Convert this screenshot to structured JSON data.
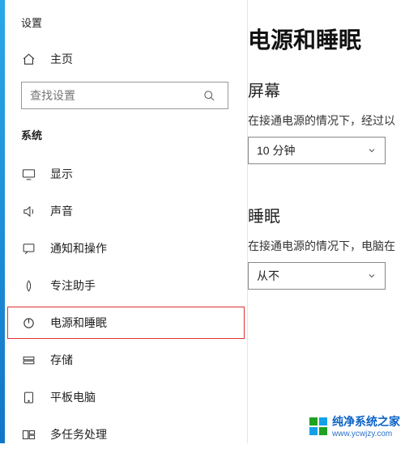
{
  "app": {
    "title": "设置"
  },
  "home": {
    "label": "主页"
  },
  "search": {
    "placeholder": "查找设置"
  },
  "group": {
    "label": "系统"
  },
  "nav": {
    "items": [
      {
        "label": "显示"
      },
      {
        "label": "声音"
      },
      {
        "label": "通知和操作"
      },
      {
        "label": "专注助手"
      },
      {
        "label": "电源和睡眠"
      },
      {
        "label": "存储"
      },
      {
        "label": "平板电脑"
      },
      {
        "label": "多任务处理"
      }
    ]
  },
  "main": {
    "title": "电源和睡眠",
    "screen_section": "屏幕",
    "screen_desc": "在接通电源的情况下，经过以",
    "screen_value": "10 分钟",
    "sleep_section": "睡眠",
    "sleep_desc": "在接通电源的情况下，电脑在",
    "sleep_value": "从不"
  },
  "watermark": {
    "name": "纯净系统之家",
    "url": "www.ycwjzy.com"
  }
}
